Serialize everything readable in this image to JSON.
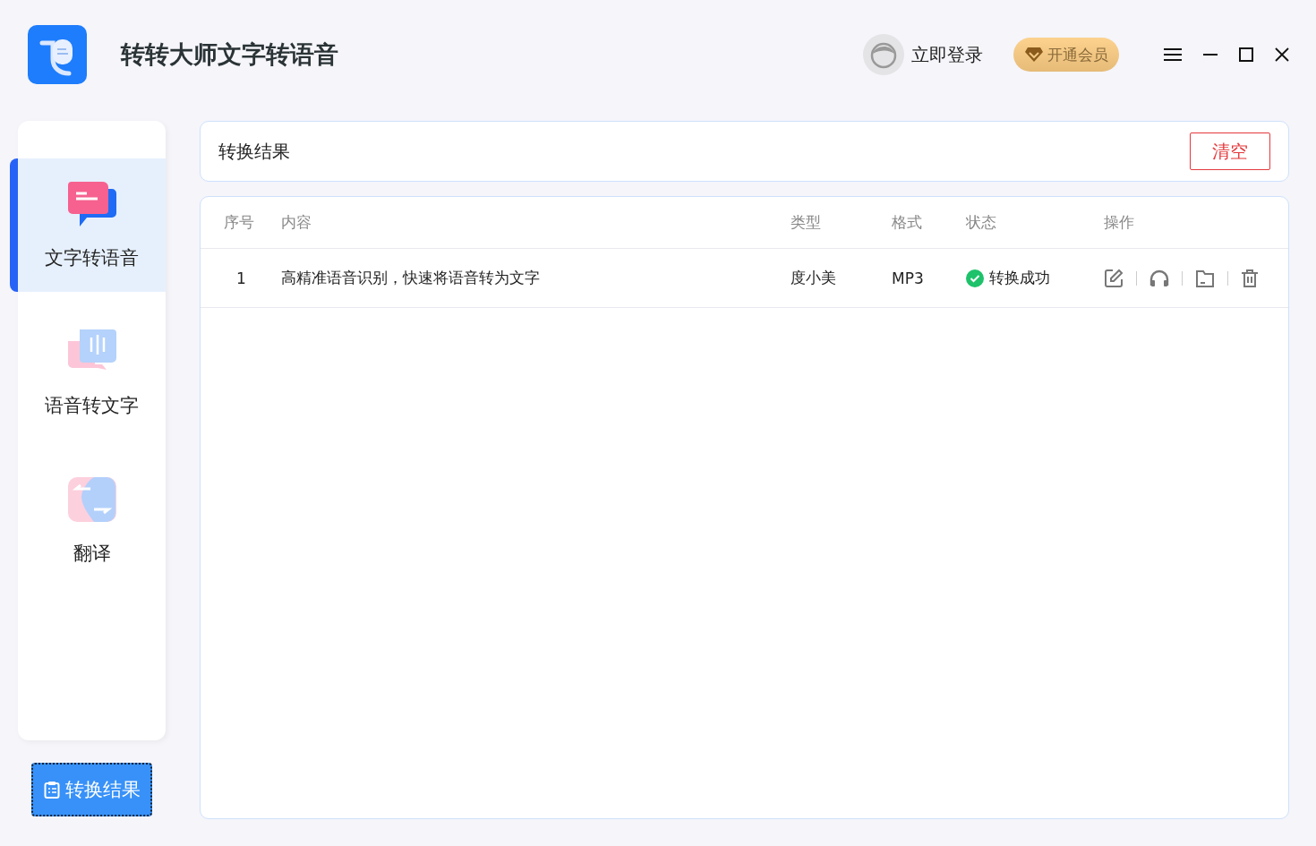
{
  "app": {
    "title": "转转大师文字转语音"
  },
  "header": {
    "login": "立即登录",
    "vip": "开通会员"
  },
  "sidebar": {
    "items": [
      {
        "label": "文字转语音",
        "kind": "tts",
        "selected": true
      },
      {
        "label": "语音转文字",
        "kind": "stt",
        "selected": false
      },
      {
        "label": "翻译",
        "kind": "translate",
        "selected": false
      }
    ],
    "results_button": "转换结果"
  },
  "result_panel": {
    "title": "转换结果",
    "clear_button": "清空"
  },
  "table": {
    "columns": [
      "序号",
      "内容",
      "类型",
      "格式",
      "状态",
      "操作"
    ],
    "rows": [
      {
        "index": "1",
        "content": "高精准语音识别，快速将语音转为文字",
        "voice": "度小美",
        "format": "MP3",
        "status": "转换成功",
        "kind": "success"
      }
    ]
  }
}
